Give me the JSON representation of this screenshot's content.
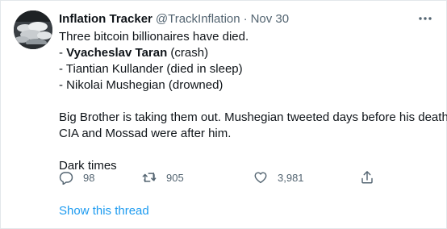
{
  "tweet": {
    "author_name": "Inflation Tracker",
    "handle": "@TrackInflation",
    "separator": "·",
    "date": "Nov 30",
    "lines": [
      "Three bitcoin billionaires have died.",
      "- ",
      "Vyacheslav Taran",
      " (crash)",
      "- Tiantian Kullander (died in sleep)",
      "- Nikolai Mushegian (drowned)",
      "Big Brother is taking them out. Mushegian tweeted days before his death",
      "CIA and Mossad were after him.",
      "Dark times"
    ],
    "replies": "98",
    "retweets": "905",
    "likes": "3,981",
    "show_thread": "Show this thread"
  },
  "icons": {
    "more": "more-horizontal-icon",
    "reply": "reply-icon",
    "retweet": "retweet-icon",
    "like": "heart-icon",
    "share": "share-icon"
  },
  "colors": {
    "text": "#0f1419",
    "secondary": "#536471",
    "link": "#1d9bf0",
    "border": "#e3e7ea"
  }
}
